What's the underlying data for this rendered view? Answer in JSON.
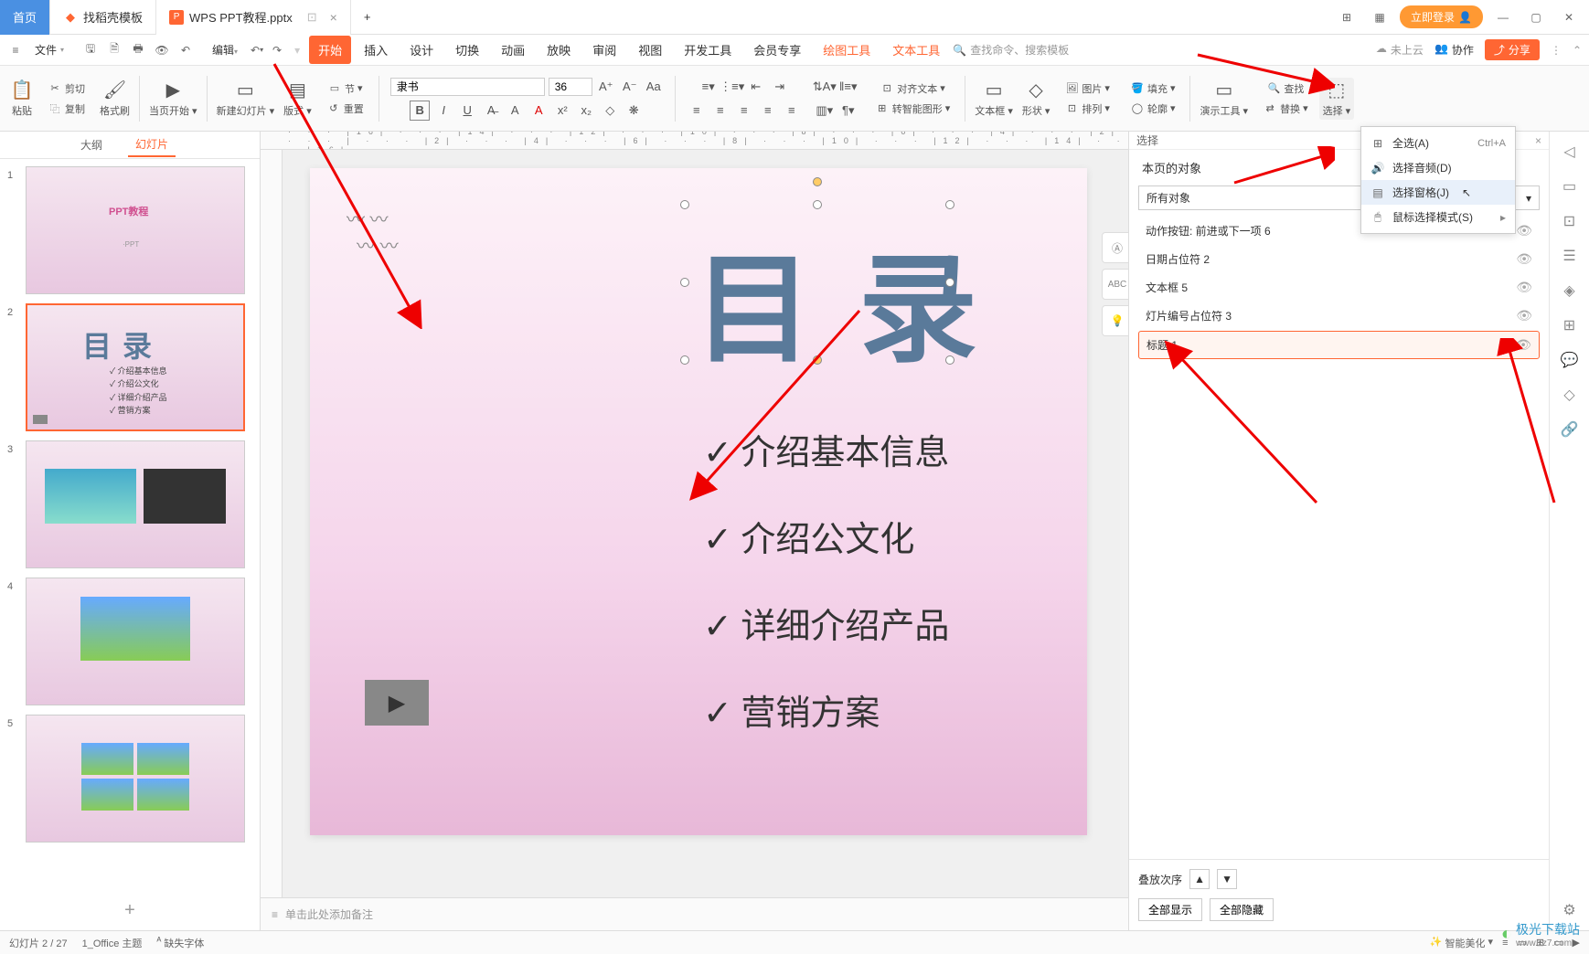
{
  "tabs": {
    "home": "首页",
    "template": "找稻壳模板",
    "file": "WPS PPT教程.pptx",
    "add": "+"
  },
  "titleRight": {
    "login": "立即登录"
  },
  "menubar": {
    "file": "文件",
    "edit": "编辑",
    "items": [
      "开始",
      "插入",
      "设计",
      "切换",
      "动画",
      "放映",
      "审阅",
      "视图",
      "开发工具",
      "会员专享"
    ],
    "drawTools": "绘图工具",
    "textTools": "文本工具",
    "searchPlaceholder": "查找命令、搜索模板",
    "cloud": "未上云",
    "coop": "协作",
    "share": "分享"
  },
  "toolbar": {
    "paste": "粘贴",
    "cut": "剪切",
    "copy": "复制",
    "formatPainter": "格式刷",
    "fromCurrent": "当页开始",
    "newSlide": "新建幻灯片",
    "layout": "版式",
    "section": "节",
    "reset": "重置",
    "fontName": "隶书",
    "fontSize": "36",
    "alignText": "对齐文本",
    "smartArt": "转智能图形",
    "textbox": "文本框",
    "shape": "形状",
    "picture": "图片",
    "arrange": "排列",
    "fill": "填充",
    "outline": "轮廓",
    "presentTools": "演示工具",
    "find": "查找",
    "replace": "替换",
    "select": "选择"
  },
  "sideTabs": {
    "outline": "大纲",
    "slides": "幻灯片"
  },
  "slide": {
    "title": "目录",
    "items": [
      "介绍基本信息",
      "介绍公文化",
      "详细介绍产品",
      "营销方案"
    ]
  },
  "thumbItems": [
    "介绍基本信息",
    "介绍公文化",
    "详细介绍产品",
    "营销方案"
  ],
  "thumb1": {
    "title": "PPT教程",
    "sub": "·PPT"
  },
  "selectionPane": {
    "title": "本页的对象",
    "levelPrefix": "选择",
    "dropdown": "所有对象",
    "items": [
      {
        "label": "动作按钮: 前进或下一项 6"
      },
      {
        "label": "日期占位符 2"
      },
      {
        "label": "文本框 5"
      },
      {
        "label": "灯片编号占位符 3"
      },
      {
        "label": "标题 1",
        "selected": true
      }
    ],
    "order": "叠放次序",
    "showAll": "全部显示",
    "hideAll": "全部隐藏"
  },
  "dropdownMenu": {
    "selectAll": "全选(A)",
    "selectAllKey": "Ctrl+A",
    "selectAudio": "选择音频(D)",
    "selectionPane": "选择窗格(J)",
    "mouseMode": "鼠标选择模式(S)"
  },
  "notes": "单击此处添加备注",
  "statusbar": {
    "slide": "幻灯片 2 / 27",
    "theme": "1_Office 主题",
    "missingFont": "缺失字体",
    "beautify": "智能美化"
  },
  "watermark": {
    "name": "极光下载站",
    "url": "www.xz7.com"
  }
}
